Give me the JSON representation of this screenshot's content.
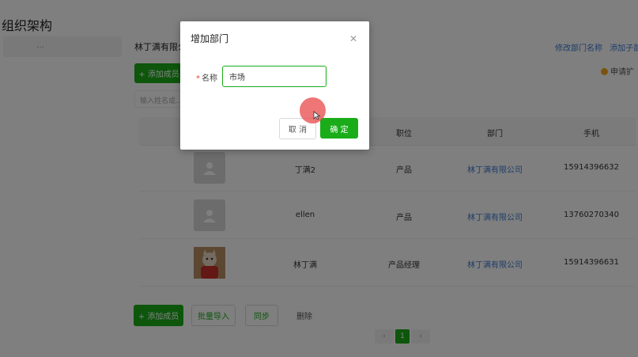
{
  "page": {
    "title": "组织架构",
    "sidebar_search": "…",
    "company_name": "林丁满有限公",
    "links": [
      "修改部门名称",
      "添加子部门"
    ],
    "apply_note": "申请扩",
    "add_member_label": "+ 添加成员",
    "member_search_placeholder": "输入姓名或…"
  },
  "table": {
    "headers": [
      "职位",
      "部门",
      "手机"
    ],
    "rows": [
      {
        "name": "丁满2",
        "position": "产品",
        "department": "林丁满有限公司",
        "phone": "15914396632",
        "avatar": "default"
      },
      {
        "name": "ellen",
        "position": "产品",
        "department": "林丁满有限公司",
        "phone": "13760270340",
        "avatar": "default"
      },
      {
        "name": "林丁满",
        "position": "产品经理",
        "department": "林丁满有限公司",
        "phone": "15914396631",
        "avatar": "cat-photo"
      }
    ]
  },
  "bottom": {
    "add_member_label": "+ 添加成员",
    "import_label": "批量导入",
    "sync_label": "同步",
    "delete_label": "删除",
    "current_page": "1"
  },
  "dialog": {
    "title": "增加部门",
    "close_icon": "close-icon",
    "name_label": "名称",
    "required_mark": "*",
    "name_value": "市场",
    "cancel_label": "取 消",
    "ok_label": "确 定"
  },
  "colors": {
    "primary_green": "#1aad19",
    "link_blue": "#3a7bd5",
    "overlay": "rgba(0,0,0,0.5)",
    "click_indicator": "#e84848"
  }
}
